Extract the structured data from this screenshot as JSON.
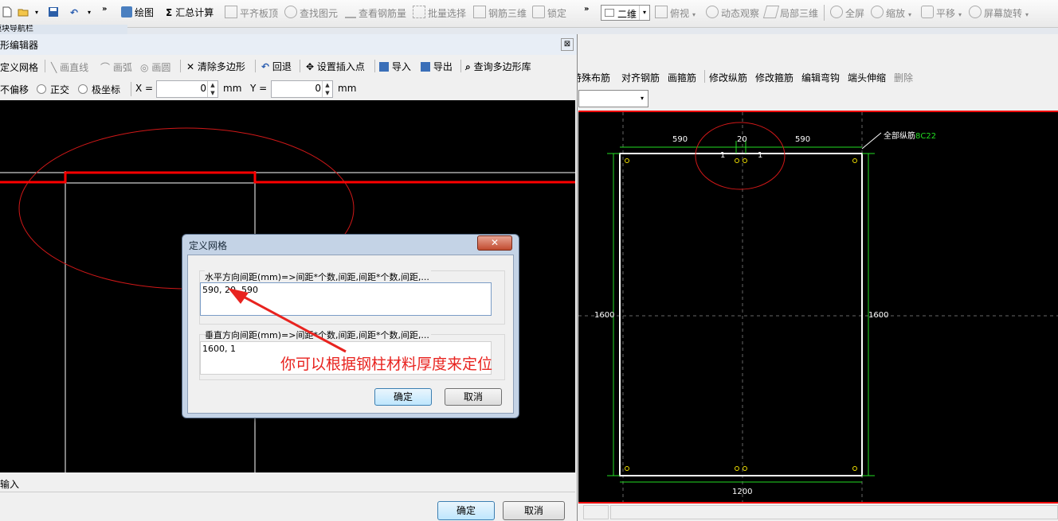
{
  "main_toolbar": {
    "draw": "绘图",
    "summary_calc": "汇总计算",
    "align_slab_top": "平齐板顶",
    "find_element": "查找图元",
    "view_rebar_qty": "查看钢筋量",
    "batch_select": "批量选择",
    "rebar_3d": "钢筋三维",
    "lock": "锁定",
    "view_mode": "二维",
    "top_view": "俯视",
    "dynamic_observe": "动态观察",
    "local_3d": "局部三维",
    "fullscreen": "全屏",
    "zoom": "缩放",
    "pan": "平移",
    "screen_rotate": "屏幕旋转"
  },
  "nav_panel": {
    "title": "模块导航栏"
  },
  "editor": {
    "title": "形编辑器",
    "toolbar": {
      "define_grid": "定义网格",
      "draw_line": "画直线",
      "draw_arc": "画弧",
      "draw_circle": "画圆",
      "clear_polygon": "清除多边形",
      "undo": "回退",
      "set_insert_point": "设置插入点",
      "import": "导入",
      "export": "导出",
      "query_library": "查询多边形库"
    },
    "options": {
      "no_offset": "不偏移",
      "orthogonal": "正交",
      "polar": "极坐标",
      "x_label": "X =",
      "x_value": "0",
      "x_unit": "mm",
      "y_label": "Y =",
      "y_value": "0",
      "y_unit": "mm"
    },
    "status": "输入",
    "ok": "确定",
    "cancel": "取消"
  },
  "grid_dialog": {
    "title": "定义网格",
    "h_label": "水平方向间距(mm)=>间距*个数,间距,间距*个数,间距,...",
    "h_value": "590, 20, 590",
    "v_label": "垂直方向间距(mm)=>间距*个数,间距,间距*个数,间距,...",
    "v_value": "1600, 1",
    "ok": "确定",
    "cancel": "取消"
  },
  "annotation": {
    "text": "你可以根据钢柱材料厚度来定位"
  },
  "rebar_toolbar": {
    "special_layout": "特殊布筋",
    "align_rebar": "对齐钢筋",
    "draw_stirrup": "画箍筋",
    "modify_long": "修改纵筋",
    "modify_stirrup": "修改箍筋",
    "edit_hook": "编辑弯钩",
    "end_extend": "端头伸缩",
    "delete": "删除"
  },
  "section": {
    "dim_left": "590",
    "dim_mid": "20",
    "dim_right": "590",
    "dim_one_a": "1",
    "dim_one_b": "1",
    "height_left": "1600",
    "height_right": "1600",
    "width_bottom": "1200",
    "all_rebar_label": "全部纵筋",
    "all_rebar_value": "8C22"
  },
  "colors": {
    "canvas_bg": "#000000",
    "grid_line": "#ffffff",
    "highlight_red": "#ff0000",
    "annotation_red": "#e8231f",
    "dim_green": "#22dd22",
    "rebar_yellow": "#f0e000",
    "dialog_frame": "#c4d3e6"
  }
}
